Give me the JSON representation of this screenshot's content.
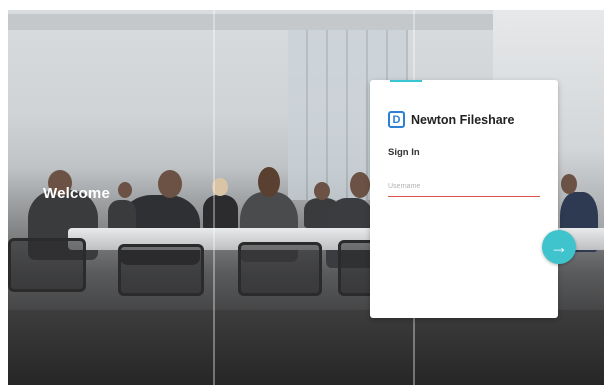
{
  "login": {
    "welcome": "Welcome",
    "app_name": "Newton Fileshare",
    "logo_letter": "D",
    "sign_in": "Sign In",
    "username_placeholder": "Username",
    "next_icon": "arrow-right-icon"
  },
  "colors": {
    "accent": "#3fc3cd",
    "logo": "#2b7fd4",
    "input_underline": "#d9534f"
  }
}
